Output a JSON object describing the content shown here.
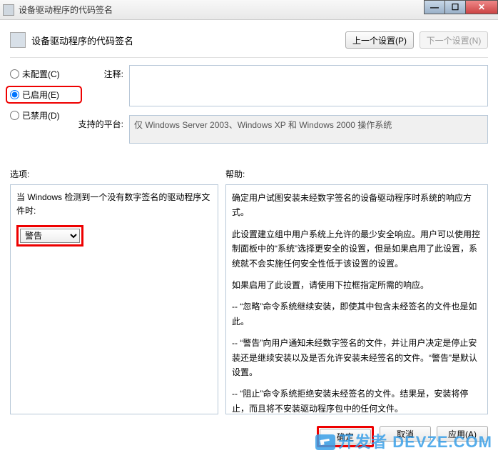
{
  "titlebar": {
    "title": "设备驱动程序的代码签名"
  },
  "header": {
    "title": "设备驱动程序的代码签名",
    "prev_button": "上一个设置(P)",
    "next_button": "下一个设置(N)"
  },
  "radios": {
    "not_configured": "未配置(C)",
    "enabled": "已启用(E)",
    "disabled": "已禁用(D)",
    "selected": "enabled"
  },
  "form": {
    "comment_label": "注释:",
    "comment_value": "",
    "platform_label": "支持的平台:",
    "platform_value": "仅 Windows Server 2003、Windows XP 和 Windows 2000 操作系统"
  },
  "options": {
    "section_label": "选项:",
    "prompt_text": "当 Windows 检测到一个没有数字签名的驱动程序文件时:",
    "dropdown_value": "警告"
  },
  "help": {
    "section_label": "帮助:",
    "paragraphs": [
      "确定用户试图安装未经数字签名的设备驱动程序时系统的响应方式。",
      "此设置建立组中用户系统上允许的最少安全响应。用户可以使用控制面板中的“系统”选择更安全的设置，但是如果启用了此设置，系统就不会实施任何安全性低于该设置的设置。",
      "如果启用了此设置，请使用下拉框指定所需的响应。",
      "-- “忽略”命令系统继续安装，即使其中包含未经签名的文件也是如此。",
      "-- “警告”向用户通知未经数字签名的文件，并让用户决定是停止安装还是继续安装以及是否允许安装未经签名的文件。“警告”是默认设置。",
      "-- “阻止”命令系统拒绝安装未经签名的文件。结果是，安装将停止，而且将不安装驱动程序包中的任何文件。"
    ]
  },
  "footer": {
    "ok": "确定",
    "cancel": "取消",
    "apply": "应用(A)"
  },
  "watermark": "开发者 DEVZE.COM"
}
